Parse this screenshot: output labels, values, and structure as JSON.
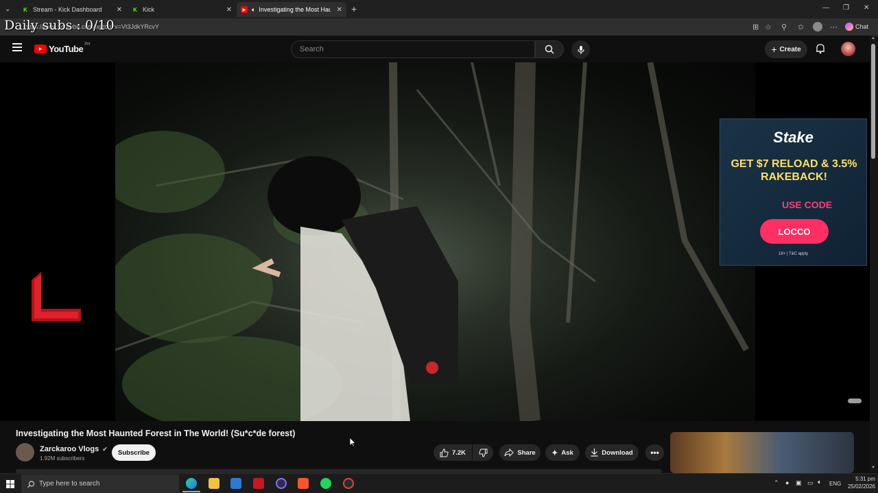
{
  "overlay": {
    "daily_subs": "Daily subs : 0/10"
  },
  "browser": {
    "tabs": [
      {
        "label": "Stream - Kick Dashboard",
        "icon": "kick-icon",
        "active": false
      },
      {
        "label": "Kick",
        "icon": "kick-icon",
        "active": false
      },
      {
        "label": "Investigating the Most Haunte",
        "icon": "youtube-icon",
        "active": true
      }
    ],
    "url": "https://www.youtube.com/watch?v=Vt3JdkYRcvY",
    "chat_label": "Chat"
  },
  "youtube": {
    "logo_text": "YouTube",
    "region": "PH",
    "search_placeholder": "Search",
    "create_label": "Create"
  },
  "ad": {
    "brand": "Stake",
    "headline": "GET $7 RELOAD & 3.5% RAKEBACK!",
    "use_code": "USE CODE",
    "code": "LOCCO",
    "fineprint": "18+ | T&C apply"
  },
  "video": {
    "title": "Investigating the Most Haunted Forest in The World! (Su*c*de forest)",
    "channel": "Zarckaroo Vlogs",
    "subscribers": "1.92M subscribers",
    "subscribe_label": "Subscribe",
    "likes": "7.2K",
    "share_label": "Share",
    "ask_label": "Ask",
    "download_label": "Download"
  },
  "taskbar": {
    "search_placeholder": "Type here to search",
    "lang": "ENG",
    "time": "5:31 pm",
    "date": "25/02/2026"
  },
  "colors": {
    "youtube_red": "#ff0000",
    "kick_green": "#53fc18",
    "accent_pink": "#ff2e63"
  }
}
